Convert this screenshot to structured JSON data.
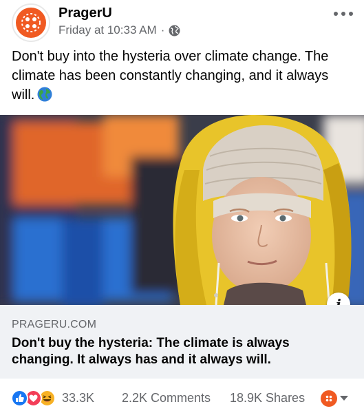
{
  "post": {
    "page_name": "PragerU",
    "timestamp": "Friday at 10:33 AM",
    "separator": "·",
    "privacy_icon": "globe-icon",
    "text": "Don't buy into the hysteria over climate change. The climate has been constantly changing, and it always will.",
    "emoji": "earth-globe-emoji"
  },
  "link_preview": {
    "domain": "PRAGERU.COM",
    "title": "Don't buy the hysteria: The climate is always changing. It always has and it always will.",
    "info_label": "i"
  },
  "engagement": {
    "reactions": [
      "like",
      "love",
      "haha"
    ],
    "reaction_count": "33.3K",
    "comments": "2.2K Comments",
    "shares": "18.9K Shares"
  },
  "colors": {
    "brand_orange": "#f05a22",
    "like_blue": "#1877f2",
    "love_red": "#f33e58",
    "haha_yellow": "#f7b125",
    "raincoat_yellow": "#e8c42a"
  }
}
